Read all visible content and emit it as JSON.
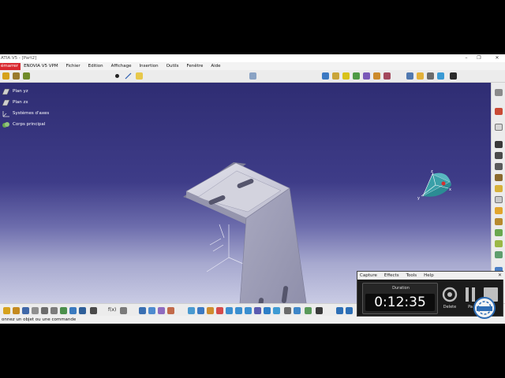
{
  "window": {
    "title": "ATIA V5 - [Part2]",
    "minimize": "–",
    "restore": "❐",
    "close": "✕"
  },
  "menu": {
    "start": "émarrer",
    "items": [
      "ENOVIA V5 VPM",
      "Fichier",
      "Edition",
      "Affichage",
      "Insertion",
      "Outils",
      "Fenêtre",
      "Aide"
    ]
  },
  "tree": {
    "nodes": [
      {
        "label": "Plan yz",
        "icon": "plane-icon"
      },
      {
        "label": "Plan zx",
        "icon": "plane-icon"
      },
      {
        "label": "Systèmes d'axes",
        "icon": "axis-system-icon"
      },
      {
        "label": "Corps principal",
        "icon": "part-body-icon"
      }
    ]
  },
  "compass": {
    "x": "x",
    "y": "y",
    "z": "z"
  },
  "toolbar": {
    "fog_label": "f(x)"
  },
  "status": {
    "message": "onnez un objet ou une commande"
  },
  "recorder": {
    "menu": [
      "Capture",
      "Effects",
      "Tools",
      "Help"
    ],
    "close": "✕",
    "duration_label": "Duration",
    "time": "0:12:35",
    "delete_label": "Delete",
    "pause_label": "Pa"
  },
  "colors": {
    "accent_red": "#d9282f",
    "viewport_top": "#2f2d73",
    "viewport_bottom": "#c9cbe4"
  }
}
